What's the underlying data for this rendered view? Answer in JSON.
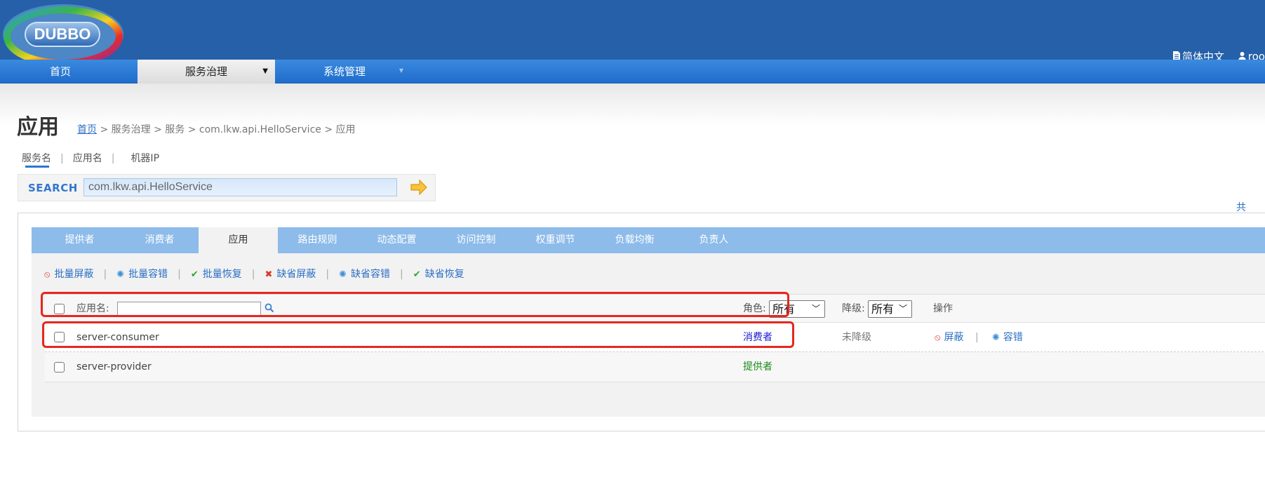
{
  "header": {
    "logo_text": "DUBBO",
    "language": "简体中文",
    "user": "roo"
  },
  "nav": {
    "items": [
      {
        "label": "首页"
      },
      {
        "label": "服务治理",
        "caret": "▼"
      },
      {
        "label": "系统管理",
        "caret": "▼"
      }
    ]
  },
  "page": {
    "title": "应用",
    "breadcrumb": {
      "home": "首页",
      "rest": " > 服务治理 > 服务 > com.lkw.api.HelloService > 应用"
    }
  },
  "search": {
    "types": [
      "服务名",
      "应用名",
      "机器IP"
    ],
    "separator": "|",
    "label": "SEARCH",
    "value": "com.lkw.api.HelloService"
  },
  "tabs": [
    "提供者",
    "消费者",
    "应用",
    "路由规则",
    "动态配置",
    "访问控制",
    "权重调节",
    "负载均衡",
    "负责人"
  ],
  "toolbar": {
    "separator": "|",
    "actions": [
      {
        "label": "批量屏蔽",
        "icon": "⦸"
      },
      {
        "label": "批量容错",
        "icon": "✺"
      },
      {
        "label": "批量恢复",
        "icon": "✔"
      },
      {
        "label": "缺省屏蔽",
        "icon": "✖"
      },
      {
        "label": "缺省容错",
        "icon": "✺"
      },
      {
        "label": "缺省恢复",
        "icon": "✔"
      }
    ]
  },
  "table": {
    "header": {
      "app_label": "应用名:",
      "role_label": "角色:",
      "role_value": "所有",
      "degrade_label": "降级:",
      "degrade_value": "所有",
      "ops_label": "操作"
    },
    "rows": [
      {
        "name": "server-consumer",
        "role": "消费者",
        "degrade": "未降级",
        "actions": [
          "屏蔽",
          "容错"
        ],
        "action_sep": "|"
      },
      {
        "name": "server-provider",
        "role": "提供者"
      }
    ]
  },
  "pager": {
    "text": "共"
  },
  "colors": {
    "header": "#2560a9",
    "tabs": "#8dbbea",
    "link": "#2a6fc4",
    "highlight": "#e8261f"
  }
}
